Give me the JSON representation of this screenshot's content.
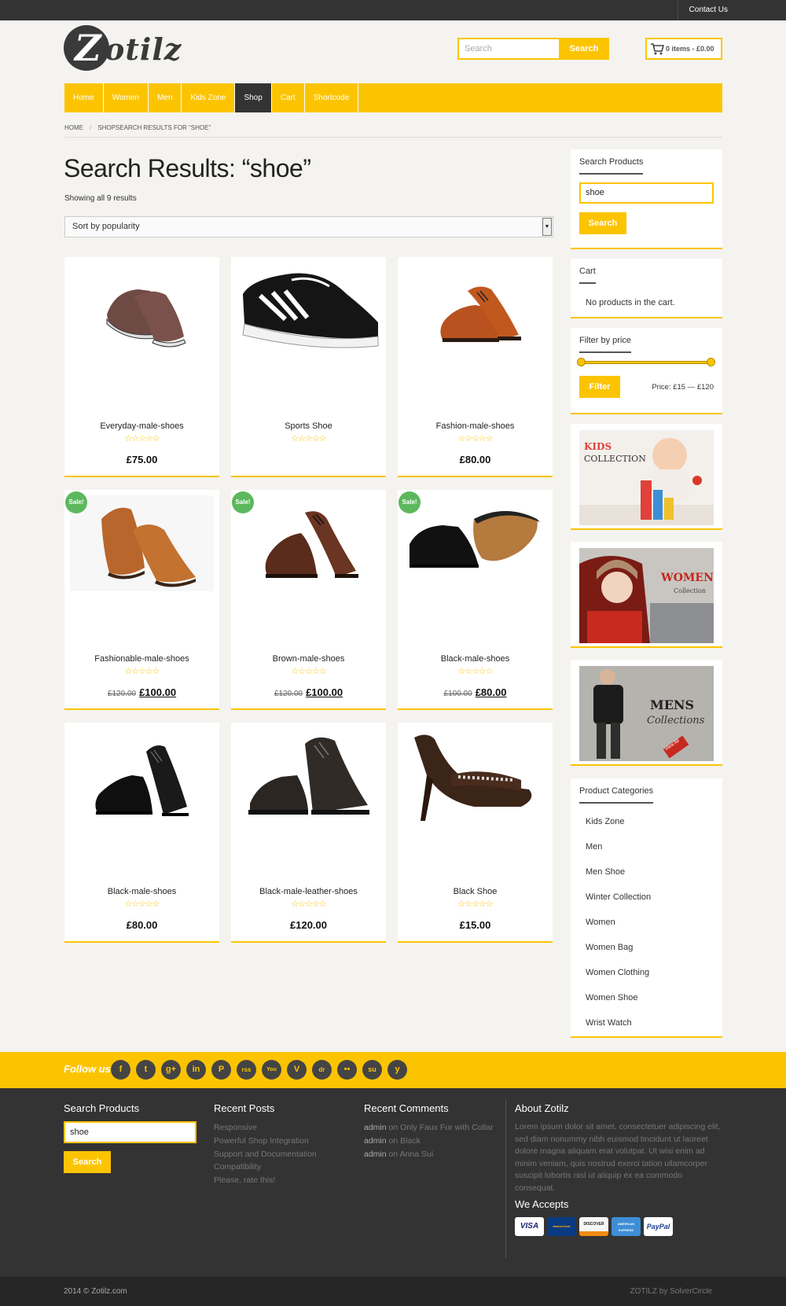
{
  "topbar": {
    "contact": "Contact Us"
  },
  "header": {
    "logo_text": "otilz",
    "logo_mark": "Z",
    "search_placeholder": "Search",
    "search_button": "Search",
    "cart_summary": "0 items - £0.00"
  },
  "nav": {
    "items": [
      "Home",
      "Women",
      "Men",
      "Kids Zone",
      "Shop",
      "Cart",
      "Shortcode"
    ],
    "active": "Shop"
  },
  "breadcrumb": {
    "home": "Home",
    "sep": "/",
    "current": "ShopSearch results for “shoe”"
  },
  "main": {
    "title": "Search Results: “shoe”",
    "count": "Showing all 9 results",
    "sort_selected": "Sort by popularity",
    "sort_arrow": "▼"
  },
  "products": [
    {
      "name": "Everyday-male-shoes",
      "stars": "☆☆☆☆☆",
      "price": "£75.00",
      "old": "",
      "sale": ""
    },
    {
      "name": "Sports Shoe",
      "stars": "☆☆☆☆☆",
      "price": "",
      "old": "",
      "sale": ""
    },
    {
      "name": "Fashion-male-shoes",
      "stars": "☆☆☆☆☆",
      "price": "£80.00",
      "old": "",
      "sale": ""
    },
    {
      "name": "Fashionable-male-shoes",
      "stars": "☆☆☆☆☆",
      "price": "£100.00",
      "old": "£120.00",
      "sale": "Sale!"
    },
    {
      "name": "Brown-male-shoes",
      "stars": "☆☆☆☆☆",
      "price": "£100.00",
      "old": "£120.00",
      "sale": "Sale!"
    },
    {
      "name": "Black-male-shoes",
      "stars": "☆☆☆☆☆",
      "price": "£80.00",
      "old": "£100.00",
      "sale": "Sale!"
    },
    {
      "name": "Black-male-shoes",
      "stars": "☆☆☆☆☆",
      "price": "£80.00",
      "old": "",
      "sale": ""
    },
    {
      "name": "Black-male-leather-shoes",
      "stars": "☆☆☆☆☆",
      "price": "£120.00",
      "old": "",
      "sale": ""
    },
    {
      "name": "Black Shoe",
      "stars": "☆☆☆☆☆",
      "price": "£15.00",
      "old": "",
      "sale": ""
    }
  ],
  "sidebar": {
    "search": {
      "title": "Search Products",
      "value": "shoe",
      "button": "Search"
    },
    "cart": {
      "title": "Cart",
      "empty": "No products in the cart."
    },
    "price_filter": {
      "title": "Filter by price",
      "button": "Filter",
      "range": "Price: £15 — £120",
      "min_fraction": 0,
      "max_fraction": 1
    },
    "ads": [
      {
        "line1": "KIDS",
        "line2": "COLLECTION"
      },
      {
        "line1": "WOMEN's",
        "line2": "Collection"
      },
      {
        "line1": "MENS",
        "line2": "Collections",
        "badge": "View All"
      }
    ],
    "categories": {
      "title": "Product Categories",
      "items": [
        "Kids Zone",
        "Men",
        "Men Shoe",
        "Winter Collection",
        "Women",
        "Women Bag",
        "Women Clothing",
        "Women Shoe",
        "Wrist Watch"
      ]
    }
  },
  "follow": {
    "label": "Follow us",
    "icons": [
      "f",
      "t",
      "g+",
      "in",
      "P",
      "rss",
      "You",
      "V",
      "dr",
      "••",
      "su",
      "y"
    ]
  },
  "footer": {
    "search": {
      "title": "Search Products",
      "value": "shoe",
      "button": "Search"
    },
    "recent_posts": {
      "title": "Recent Posts",
      "items": [
        "Responsive",
        "Powerful Shop Integration",
        "Support and Documentation",
        "Compatibility",
        "Please, rate this!"
      ]
    },
    "recent_comments": {
      "title": "Recent Comments",
      "items": [
        {
          "author": "admin",
          "on": "on",
          "post": "Only Faux Fur with Collar"
        },
        {
          "author": "admin",
          "on": "on",
          "post": "Black"
        },
        {
          "author": "admin",
          "on": "on",
          "post": "Anna Sui"
        }
      ]
    },
    "about": {
      "title": "About Zotilz",
      "text": "Lorem ipsum dolor sit amet, consectetuer adipiscing elit, sed diam nonummy nibh euismod tincidunt ut laoreet dolore magna aliquam erat volutpat. Ut wisi enim ad minim veniam, quis nostrud exerci tation ullamcorper suscipit lobortis nisl ut aliquip ex ea commodo consequat."
    },
    "accepts": {
      "title": "We Accepts",
      "cards": [
        "VISA",
        "MasterCard",
        "DISCOVER",
        "AMERICAN EXPRESS",
        "PayPal"
      ]
    },
    "copyright_year": "2014 ©",
    "copyright_site": "Zotilz.com",
    "credit": "ZOTILZ by SolverCircle"
  },
  "colors": {
    "accent": "#fcc400",
    "dark": "#333333",
    "sale": "#5cb85c"
  }
}
